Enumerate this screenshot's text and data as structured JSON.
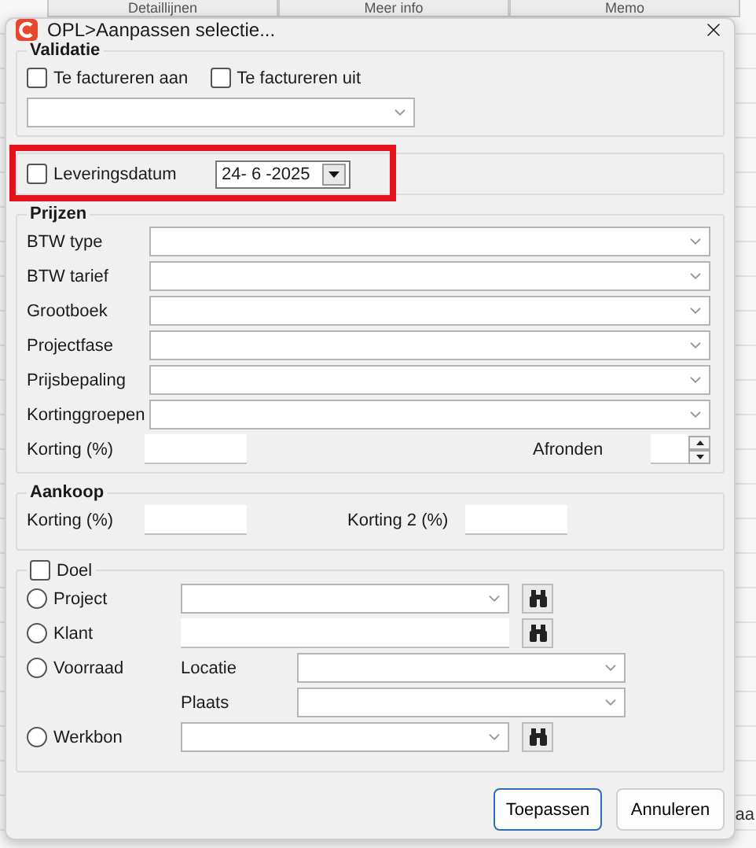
{
  "background": {
    "tabs": [
      "Detaillijnen",
      "Meer info",
      "Memo"
    ],
    "side_text": "aa"
  },
  "dialog": {
    "title": "OPL>Aanpassen selectie...",
    "validatie": {
      "title": "Validatie",
      "checkboxes": [
        {
          "label": "Te factureren aan",
          "checked": false
        },
        {
          "label": "Te factureren uit",
          "checked": false
        }
      ]
    },
    "delivery": {
      "label": "Leveringsdatum",
      "checked": false,
      "date": "24- 6 -2025",
      "highlighted": true
    },
    "prijzen": {
      "title": "Prijzen",
      "selects": [
        "BTW type",
        "BTW tarief",
        "Grootboek",
        "Projectfase",
        "Prijsbepaling",
        "Kortinggroepen"
      ],
      "korting_label": "Korting (%)",
      "afronden_label": "Afronden"
    },
    "aankoop": {
      "title": "Aankoop",
      "korting_label": "Korting (%)",
      "korting2_label": "Korting 2 (%)"
    },
    "doel": {
      "label": "Doel",
      "checked": false,
      "options": [
        {
          "kind": "lookup",
          "label": "Project",
          "selected": false
        },
        {
          "kind": "text",
          "label": "Klant",
          "selected": false
        },
        {
          "kind": "location",
          "label": "Voorraad",
          "selected": false,
          "sub_labels": [
            "Locatie",
            "Plaats"
          ]
        },
        {
          "kind": "lookup",
          "label": "Werkbon",
          "selected": false
        }
      ]
    },
    "buttons": [
      {
        "label": "Toepassen",
        "default": true
      },
      {
        "label": "Annuleren",
        "default": false
      }
    ]
  }
}
